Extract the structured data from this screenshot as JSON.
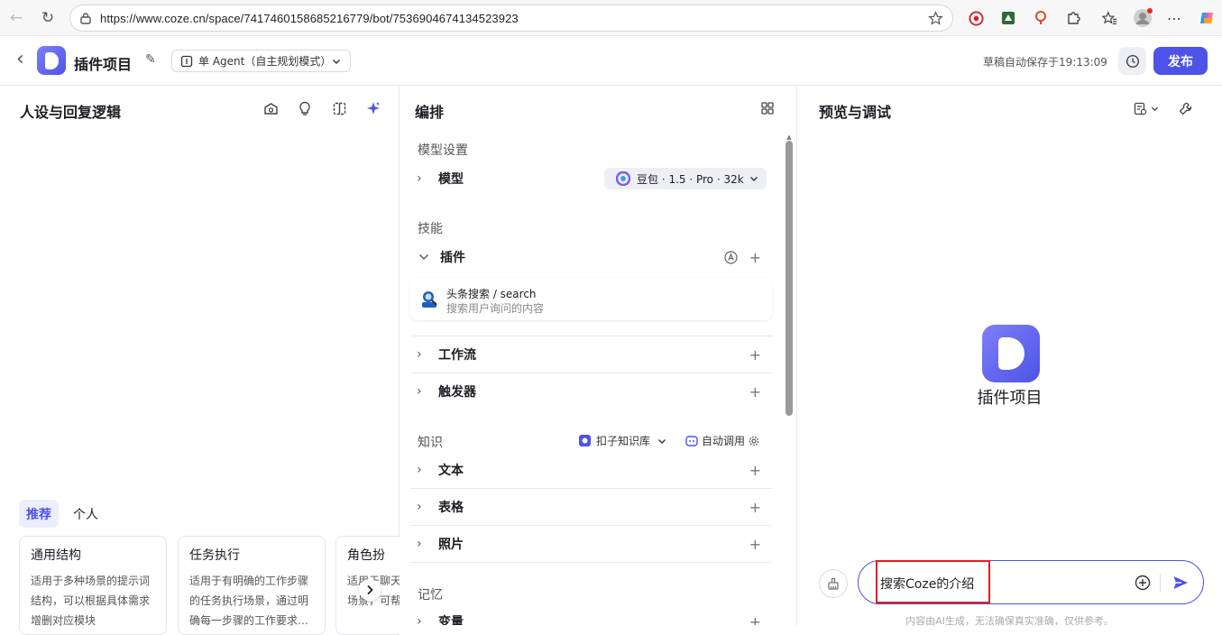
{
  "browser": {
    "url": "https://www.coze.cn/space/7417460158685216779/bot/7536904674134523923",
    "back": "←",
    "reload": "↻",
    "more": "⋯"
  },
  "header": {
    "back": "‹",
    "project_title": "插件项目",
    "edit_icon": "✎",
    "mode_label": "单 Agent（自主规划模式）",
    "save_status": "草稿自动保存于19:13:09",
    "publish_label": "发布"
  },
  "left_panel": {
    "title": "人设与回复逻辑",
    "tabs": [
      "推荐",
      "个人"
    ],
    "cards": [
      {
        "title": "通用结构",
        "desc": "适用于多种场景的提示词结构，可以根据具体需求增删对应模块"
      },
      {
        "title": "任务执行",
        "desc": "适用于有明确的工作步骤的任务执行场景，通过明确每一步骤的工作要求…"
      },
      {
        "title": "角色扮",
        "desc": "适用于聊天陪伴、互动娱乐场景，可帮助塑造个"
      }
    ]
  },
  "mid_panel": {
    "title": "编排",
    "model_section": "模型设置",
    "model_label": "模型",
    "model_value": "豆包 · 1.5 · Pro · 32k",
    "skills_section": "技能",
    "plugin_label": "插件",
    "plugin_item_name": "头条搜索 / search",
    "plugin_item_desc": "搜索用户询问的内容",
    "workflow_label": "工作流",
    "trigger_label": "触发器",
    "knowledge_section": "知识",
    "kb_select": "扣子知识库",
    "auto_call": "自动调用",
    "text_label": "文本",
    "table_label": "表格",
    "photo_label": "照片",
    "memory_section": "记忆",
    "variable_label": "变量"
  },
  "right_panel": {
    "title": "预览与调试",
    "bot_name": "插件项目",
    "input_value": "搜索Coze的介绍",
    "disclaimer": "内容由AI生成，无法确保真实准确，仅供参考。"
  }
}
